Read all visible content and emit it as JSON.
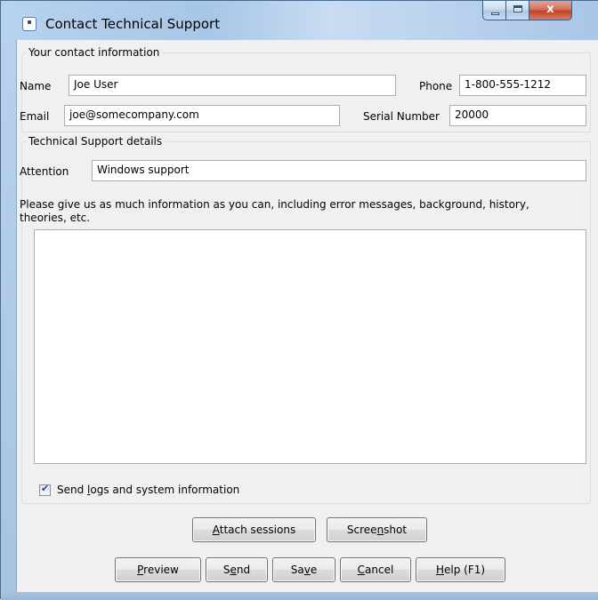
{
  "window": {
    "title": "Contact Technical Support",
    "close_glyph": "x"
  },
  "contact": {
    "legend": "Your contact information",
    "name_label": "Name",
    "name_value": "Joe User",
    "phone_label": "Phone",
    "phone_value": "1-800-555-1212",
    "email_label": "Email",
    "email_value": "joe@somecompany.com",
    "serial_label": "Serial Number",
    "serial_value": "20000"
  },
  "details": {
    "legend": "Technical Support details",
    "attention_label": "Attention",
    "attention_value": "Windows support",
    "instructions_line1": "Please give us as much information as you can, including error messages, background, history,",
    "instructions_line2": "theories, etc.",
    "description_value": ""
  },
  "options": {
    "send_logs": {
      "pre": "Send ",
      "mnemonic": "l",
      "post": "ogs and system information",
      "checked": true
    }
  },
  "buttons": {
    "attach": {
      "pre": "",
      "mnemonic": "A",
      "post": "ttach sessions"
    },
    "screenshot": {
      "pre": "Scree",
      "mnemonic": "n",
      "post": "shot"
    },
    "preview": {
      "pre": "",
      "mnemonic": "P",
      "post": "review"
    },
    "send": {
      "pre": "S",
      "mnemonic": "e",
      "post": "nd"
    },
    "save": {
      "pre": "Sa",
      "mnemonic": "v",
      "post": "e"
    },
    "cancel": {
      "pre": "",
      "mnemonic": "C",
      "post": "ancel"
    },
    "help": {
      "pre": "",
      "mnemonic": "H",
      "post": "elp (F1)"
    }
  }
}
